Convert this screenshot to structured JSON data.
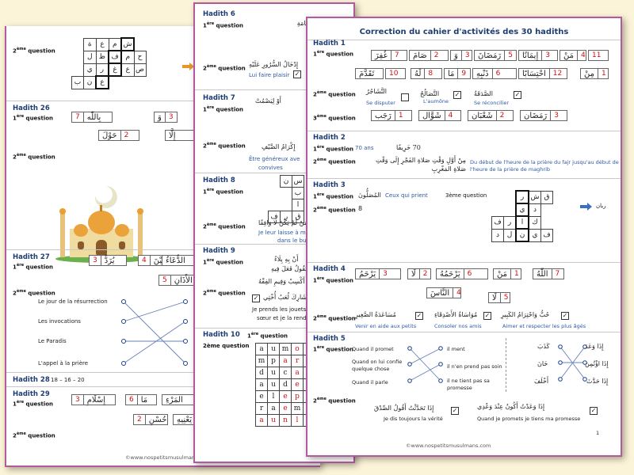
{
  "p3": {
    "h26": "Hadith 26",
    "h27": "Hadith 27",
    "h28": "Hadith 28",
    "h28_ans": "18 – 16 – 20",
    "h29": "Hadith 29",
    "q1": "1ère question",
    "q2": "2ème question",
    "h26_boxes": [
      {
        "n": "7",
        "w": "بِاللّٰه"
      },
      {
        "n": "3",
        "w": "وَ"
      },
      {
        "n": "2",
        "w": "حَوْلَ"
      },
      {
        "n": "",
        "w": "إِلَّا"
      }
    ],
    "h27_boxes": [
      {
        "n": "3",
        "w": "يُرَدُّ"
      },
      {
        "n": "4",
        "w": "بَيْنَ"
      },
      {
        "n": "",
        "w": "الدُّعَاءُ"
      },
      {
        "n": "5",
        "w": "الأَذَانِ"
      }
    ],
    "h27_left": [
      "Le jour de la résurrection",
      "Les invocations",
      "Le Paradis",
      "L'appel à la prière"
    ],
    "h29_boxes": [
      {
        "n": "3",
        "w": "إِسْلَامِ"
      },
      {
        "n": "6",
        "w": "مَا"
      },
      {
        "n": "",
        "w": "المَرْءِ"
      },
      {
        "n": "2",
        "w": "حُسْنِ"
      },
      {
        "n": "",
        "w": "يَعْنِيهِ"
      }
    ],
    "grid_rows": [
      [
        "ة",
        "ع",
        "م",
        "ش"
      ],
      [
        "ل",
        "ظ",
        "ف",
        "م",
        "ح"
      ],
      [
        "ي",
        "ر",
        "غ",
        "ع",
        "ص"
      ],
      [
        "ب",
        "ن",
        "ع"
      ]
    ],
    "footer": "©www.nospetitsmusulmans.com"
  },
  "p2": {
    "h6": "Hadith 6",
    "h7": "Hadith 7",
    "h8": "Hadith 8",
    "h9": "Hadith 9",
    "h10": "Hadith 10",
    "q1": "1ère question",
    "q2": "2ème question",
    "h6_q1_ar": "مَنْ كُرَبِ يَوْمِ القِيَامَةِ",
    "h6_q2_ar": "إِدْخَالُ السُّرُورِ عَلَيْهِ",
    "h6_q2_fr": "Lui faire plaisir",
    "h7_q1_ar": "أَوْ لِيَصْمُتْ",
    "h7_q2_ar": "إِكْرَامُ الضَّيْفِ",
    "h7_q2_fr": "Être généreux ave",
    "h7_q2_fr2": "convives",
    "h8_q2_ar": "فَمَنْ لَمْ يَكُنْ لَا وَافِقًا",
    "h8_q2_fr": "Je leur laisse à m",
    "h8_q2_fr2": "dans le bu",
    "h8_grid": [
      [
        "ن",
        "س"
      ],
      [
        "ب",
        "ا",
        "ر"
      ],
      [
        "ف",
        "ر",
        "ق"
      ]
    ],
    "h9_q1_ar": "أَنْ بِهِ بِلَاءً",
    "h9_q1_ar2": "يَقُولُ فَعَلَ فِيهِ",
    "h9_q2_ar": "ابْنُ أَكْسِبْ وَفِيمِ الفِقْهُ",
    "h9_q2_ar2": "شَارِكَ لُعَبُ أُخْتِي",
    "h9_q2_fr": "Je prends les jouets",
    "h9_q2_fr2": "sœur et je la rends",
    "h10_q2_fr": "2ème question",
    "letter_grid": [
      [
        "a",
        "u",
        "m",
        "o",
        "t"
      ],
      [
        "m",
        "p",
        "a",
        "r",
        "t"
      ],
      [
        "d",
        "u",
        "c",
        "a",
        "m"
      ],
      [
        "a",
        "u",
        "d",
        "e",
        "r"
      ],
      [
        "e",
        "l",
        "e",
        "p",
        "e"
      ],
      [
        "r",
        "a",
        "e",
        "m",
        "u"
      ],
      [
        "a",
        "u",
        "n",
        "l",
        "r"
      ]
    ]
  },
  "p1": {
    "title": "Correction du cahier d'activités des 30 hadiths",
    "h1": "Hadith 1",
    "h2": "Hadith 2",
    "h3": "Hadith 3",
    "h4": "Hadith 4",
    "h5": "Hadith 5",
    "q1": "1ère question",
    "q2": "2ème question",
    "q3": "3ème question",
    "h1_row1": [
      {
        "n": "7",
        "w": "غُفِرَ"
      },
      {
        "n": "2",
        "w": "صَامَ"
      },
      {
        "n": "3",
        "w": "وَ"
      },
      {
        "n": "5",
        "w": "رَمَضَانَ"
      },
      {
        "n": "3",
        "w": "إِيمَانًا"
      },
      {
        "n": "4",
        "w": "مَنْ"
      },
      {
        "n": "11",
        "w": ""
      }
    ],
    "h1_row2": [
      {
        "n": "",
        "w": "تَقَدَّمَ"
      },
      {
        "n": "10",
        "w": ""
      },
      {
        "n": "8",
        "w": "لَهُ"
      },
      {
        "n": "9",
        "w": "مَا"
      },
      {
        "n": "6",
        "w": "ذَنْبِهِ"
      },
      {
        "n": "12",
        "w": "احْتِسَابًا"
      },
      {
        "n": "1",
        "w": "مِنْ"
      }
    ],
    "h1_q2": [
      {
        "ar": "الصَّدَقَةُ",
        "fr": "L'aumône",
        "c": true
      },
      {
        "ar": "التَّصَالُحُ",
        "fr": "Se réconcilier",
        "c": true
      },
      {
        "ar": "التَّشَاجُرُ",
        "fr": "Se disputer",
        "c": false
      }
    ],
    "h1_q3": [
      {
        "n": "1",
        "w": "رَجَب"
      },
      {
        "n": "4",
        "w": "شَوَّال"
      },
      {
        "n": "2",
        "w": "شَعْبَان"
      },
      {
        "n": "3",
        "w": "رَمَضَان"
      }
    ],
    "h2_q1_fr": "70 ans",
    "h2_q1_ar": "70 خَرِيفًا",
    "h2_q2_ar": "مِنْ أَوَّلِ وَقْتِ صَلاةِ الفَجْرِ إِلَى وَقْتِ صَلاةِ المَغْرِبِ",
    "h2_q2_fr": "Du début de l'heure de la prière du fajr jusqu'au début de l'heure de la prière de maghrib",
    "h3_q1_fr": "Ceux qui prient",
    "h3_q1_ar": "المُصَلُّونَ",
    "h3_q2": "8",
    "h3_q3": "3ème question",
    "h3_grid": [
      [
        "",
        "",
        "ر",
        "ش",
        "ق"
      ],
      [
        "",
        "",
        "ي",
        "د"
      ],
      [
        "ف",
        "ر",
        "ا",
        "ك"
      ],
      [
        "د",
        "ل",
        "ن",
        "ي",
        "ف"
      ]
    ],
    "h3_word": "ريان",
    "h4_row1": [
      {
        "n": "7",
        "w": "اللّٰهُ"
      },
      {
        "n": "1",
        "w": "مَنْ"
      },
      {
        "n": "6",
        "w": "يَرْحَمُهُ"
      },
      {
        "n": "2",
        "w": "لَا"
      },
      {
        "n": "3",
        "w": "يَرْحَمُ"
      }
    ],
    "h4_row2": [
      {
        "n": "4",
        "w": "النَّاسَ"
      },
      {
        "n": "5",
        "w": "لَا"
      }
    ],
    "h4_q2": [
      {
        "ar": "حُبُّ وَاحْتِرَامُ الكَبِيرِ",
        "fr": "Aimer et respecter les plus âgés"
      },
      {
        "ar": "مُوَاسَاةُ الأَصْدِقَاءِ",
        "fr": "Consoler nos amis"
      },
      {
        "ar": "مُسَاعَدَةُ الصَّغِيرِ",
        "fr": "Venir en aide aux petits"
      }
    ],
    "h5_left": [
      "Quand il promet",
      "Quand on lui confie quelque chose",
      "Quand il parle"
    ],
    "h5_right": [
      "il ment",
      "il n'en prend pas soin",
      "il ne tient pas sa promesse"
    ],
    "h5_ar_left": [
      "إِذَا وَعَدَ",
      "إِذَا اؤْتُمِنَ",
      "إِذَا حَدَّثَ"
    ],
    "h5_ar_right": [
      "كَذَبَ",
      "خَانَ",
      "أَخْلَفَ"
    ],
    "h5_q2": [
      {
        "ar": "إِذَا وَعَدْتُ أَكُونُ عِنْدَ وَعْدِي",
        "fr": "Quand je promets je tiens ma promesse"
      },
      {
        "ar": "إِذَا تَحَدَّثْتُ أَقُولُ الصِّدْقَ",
        "fr": "Je dis toujours la vérité"
      }
    ],
    "page_num": "1",
    "footer": "©www.nospetitsmusulmans.com"
  },
  "colors": {
    "background": "#fcf4d8",
    "border": "#b25a9c",
    "heading": "#1e3d70",
    "number": "#cc1111",
    "french_blue": "#2d5aa5",
    "arrow": "#e8952a"
  },
  "icons": [
    "mosque-illustration",
    "checkbox-checked-icon",
    "right-arrow-icon"
  ]
}
